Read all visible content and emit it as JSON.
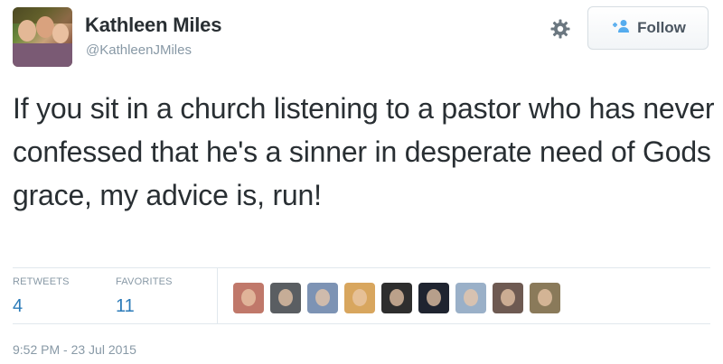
{
  "user": {
    "name": "Kathleen Miles",
    "handle": "@KathleenJMiles"
  },
  "actions": {
    "follow_label": "Follow",
    "settings_icon": "gear-icon",
    "follow_icon": "add-user-icon"
  },
  "tweet": {
    "text": "If you sit in a church listening to a pastor who has never confessed that he's a sinner in desperate need of Gods grace, my advice is, run!"
  },
  "stats": {
    "retweets_label": "RETWEETS",
    "retweets_count": "4",
    "favorites_label": "FAVORITES",
    "favorites_count": "11"
  },
  "favoriters": {
    "count_shown": 9,
    "colors": [
      "#c0786a",
      "#5a5e62",
      "#7d93b4",
      "#d8a65e",
      "#2e2e2e",
      "#1f2430",
      "#9ab0c8",
      "#6e5a52",
      "#8a7a5a"
    ]
  },
  "timestamp": "9:52 PM - 23 Jul 2015",
  "colors": {
    "link": "#2b7bb9",
    "muted": "#8899a6",
    "text": "#292f33",
    "divider": "#e1e8ed"
  }
}
